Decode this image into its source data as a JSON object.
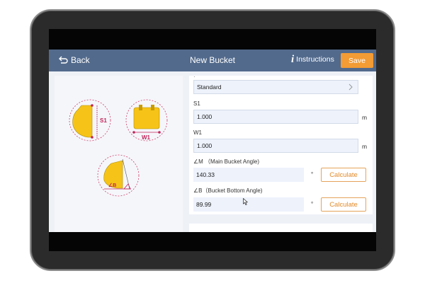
{
  "header": {
    "back_label": "Back",
    "title": "New Bucket",
    "instructions_label": "Instructions",
    "save_label": "Save"
  },
  "form": {
    "type_value": "Standard",
    "s1": {
      "label": "S1",
      "value": "1.000",
      "unit": "m"
    },
    "w1": {
      "label": "W1",
      "value": "1.000",
      "unit": "m"
    },
    "angle_m": {
      "label": "∠M （Main Bucket Angle)",
      "value": "140.33",
      "unit": "°",
      "button": "Calculate"
    },
    "angle_b": {
      "label": "∠B（Bucket Bottom Angle)",
      "value": "89.99",
      "unit": "°",
      "button": "Calculate"
    }
  },
  "diagrams": {
    "s1_label": "S1",
    "w1_label": "W1",
    "b_label": "∠B"
  },
  "colors": {
    "header": "#526a8c",
    "accent": "#f39b34",
    "bucket_yellow": "#f6c418",
    "dim_red": "#c0245a"
  }
}
